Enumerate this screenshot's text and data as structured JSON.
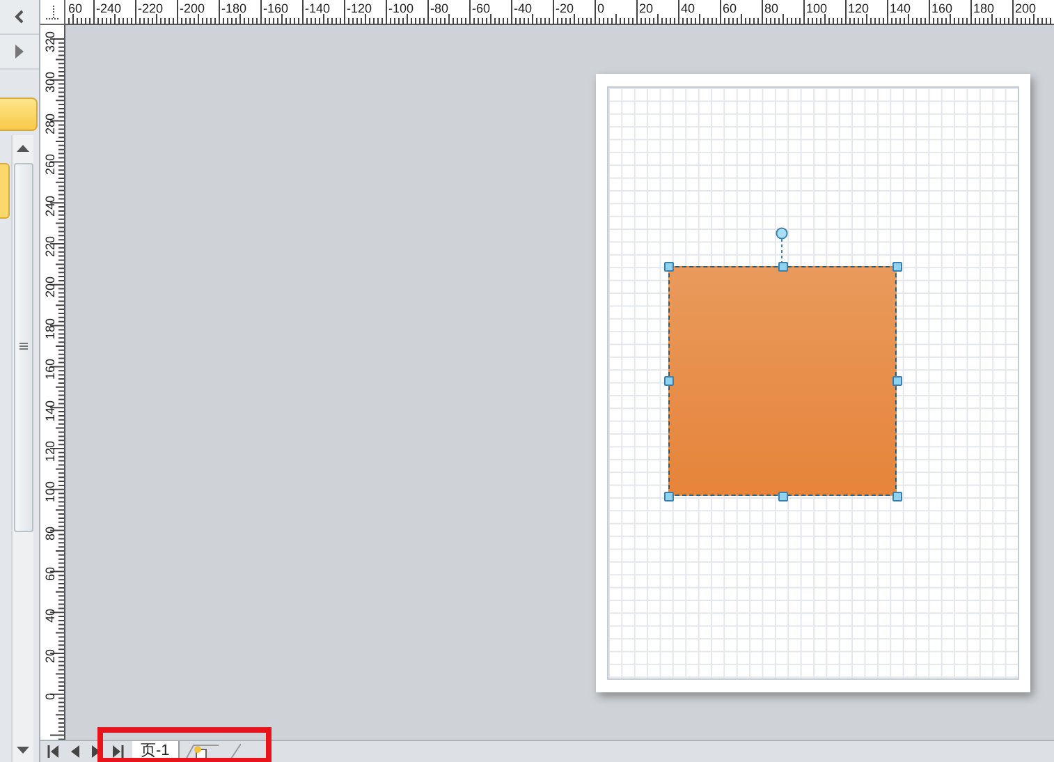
{
  "rulers": {
    "horizontal": [
      "60",
      "-240",
      "-220",
      "-200",
      "-180",
      "-160",
      "-140",
      "-120",
      "-100",
      "-80",
      "-60",
      "-40",
      "-20",
      "0",
      "20",
      "40",
      "60",
      "80",
      "100",
      "120",
      "140",
      "160",
      "180",
      "200"
    ],
    "vertical": [
      "320",
      "300",
      "280",
      "260",
      "240",
      "220",
      "200",
      "180",
      "160",
      "140",
      "120",
      "100",
      "80",
      "60",
      "40",
      "20",
      "0"
    ]
  },
  "drawing_page": {
    "shape": {
      "kind": "rectangle",
      "selected": true
    }
  },
  "page_tabs": {
    "tabs": [
      {
        "label": "页-1",
        "selected": true
      }
    ]
  }
}
